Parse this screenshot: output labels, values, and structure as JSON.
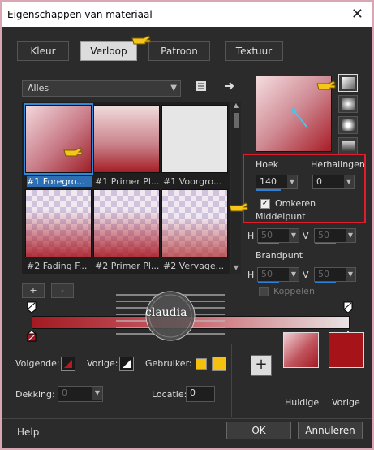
{
  "window": {
    "title": "Eigenschappen van materiaal",
    "close_glyph": "✕"
  },
  "tabs": [
    {
      "label": "Kleur"
    },
    {
      "label": "Verloop",
      "active": true
    },
    {
      "label": "Patroon"
    },
    {
      "label": "Textuur"
    }
  ],
  "library": {
    "category": "Alles",
    "thumbnails": [
      {
        "label": "#1 Foregro...",
        "selected": true
      },
      {
        "label": "#1 Primer Pl..."
      },
      {
        "label": "#1 Voorgro..."
      },
      {
        "label": "#2 Fading F..."
      },
      {
        "label": "#2 Primer Pl..."
      },
      {
        "label": "#2 Vervage..."
      }
    ],
    "add_label": "+",
    "remove_label": "-"
  },
  "settings": {
    "hoek_label": "Hoek",
    "hoek_value": "140",
    "herhalingen_label": "Herhalingen",
    "herhalingen_value": "0",
    "omkeren_label": "Omkeren",
    "omkeren_checked": true,
    "middelpunt_label": "Middelpunt",
    "middelpunt_h": "50",
    "middelpunt_v": "50",
    "brandpunt_label": "Brandpunt",
    "brandpunt_h": "50",
    "brandpunt_v": "50",
    "h_label": "H",
    "v_label": "V",
    "koppelen_label": "Koppelen"
  },
  "bottom": {
    "volgende_label": "Volgende:",
    "vorige_label": "Vorige:",
    "gebruiker_label": "Gebruiker:",
    "dekking_label": "Dekking:",
    "dekking_value": "0",
    "locatie_label": "Locatie:",
    "locatie_value": "0",
    "huidige_label": "Huidige",
    "vorige_swatch_label": "Vorige",
    "plus_label": "+",
    "huidige_color": "#c0545d",
    "vorige_color": "#a6141a",
    "gebruiker_color": "#f4c10f"
  },
  "watermark": {
    "text": "claudia"
  },
  "footer": {
    "help": "Help",
    "ok": "OK",
    "cancel": "Annuleren"
  }
}
